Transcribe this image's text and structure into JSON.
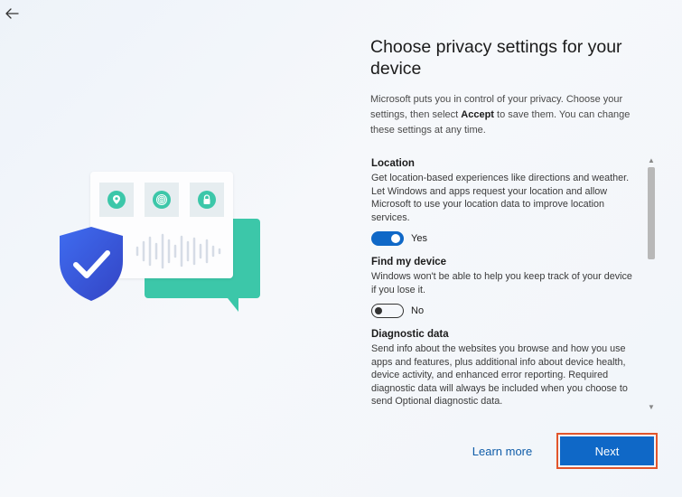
{
  "window": {
    "back_icon": "arrow-left-icon"
  },
  "header": {
    "title": "Choose privacy settings for your device",
    "description_pre": "Microsoft puts you in control of your privacy. Choose your settings, then select ",
    "description_bold": "Accept",
    "description_post": " to save them. You can change these settings at any time."
  },
  "illustration": {
    "icons": [
      "location-pin-icon",
      "fingerprint-icon",
      "lock-icon",
      "shield-check-icon",
      "chat-bubble-icon",
      "sound-wave-icon"
    ],
    "colors": {
      "accent": "#3cc7a9",
      "shield": "#3b56d6",
      "card": "#fdfdfe"
    }
  },
  "settings": [
    {
      "title": "Location",
      "text": "Get location-based experiences like directions and weather. Let Windows and apps request your location and allow Microsoft to use your location data to improve location services.",
      "state": true,
      "state_label": "Yes"
    },
    {
      "title": "Find my device",
      "text": "Windows won't be able to help you keep track of your device if you lose it.",
      "state": false,
      "state_label": "No"
    },
    {
      "title": "Diagnostic data",
      "text": "Send info about the websites you browse and how you use apps and features, plus additional info about device health, device activity, and enhanced error reporting. Required diagnostic data will always be included when you choose to send Optional diagnostic data."
    }
  ],
  "footer": {
    "learn_more_label": "Learn more",
    "next_label": "Next"
  },
  "colors": {
    "primary": "#0f68c7",
    "highlight_outline": "#e2552b",
    "link": "#0f5ca8"
  }
}
